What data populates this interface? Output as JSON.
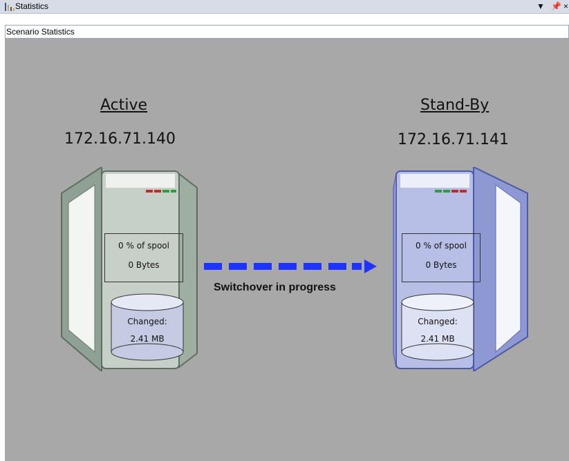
{
  "window": {
    "title": "Statistics",
    "pin_glyph": "↓ ↑ ×"
  },
  "subheader": {
    "label": "Scenario Statistics"
  },
  "active": {
    "role": "Active",
    "ip": "172.16.71.140",
    "spool_percent": "0 % of spool",
    "spool_bytes": "0 Bytes",
    "changed_label": "Changed:",
    "changed_value": "2.41 MB",
    "led_colors": [
      "#c62828",
      "#c62828",
      "#2e9d3a",
      "#2e9d3a"
    ]
  },
  "standby": {
    "role": "Stand-By",
    "ip": "172.16.71.141",
    "spool_percent": "0 % of spool",
    "spool_bytes": "0 Bytes",
    "changed_label": "Changed:",
    "changed_value": "2.41 MB",
    "led_colors": [
      "#2e9d3a",
      "#2e9d3a",
      "#c62828",
      "#c62828"
    ]
  },
  "status": {
    "text": "Switchover in progress"
  },
  "colors": {
    "canvas": "#a8a8a8",
    "arrow": "#1f33ff",
    "active_server": "#c7d0c8",
    "standby_server": "#b7bfe6"
  }
}
